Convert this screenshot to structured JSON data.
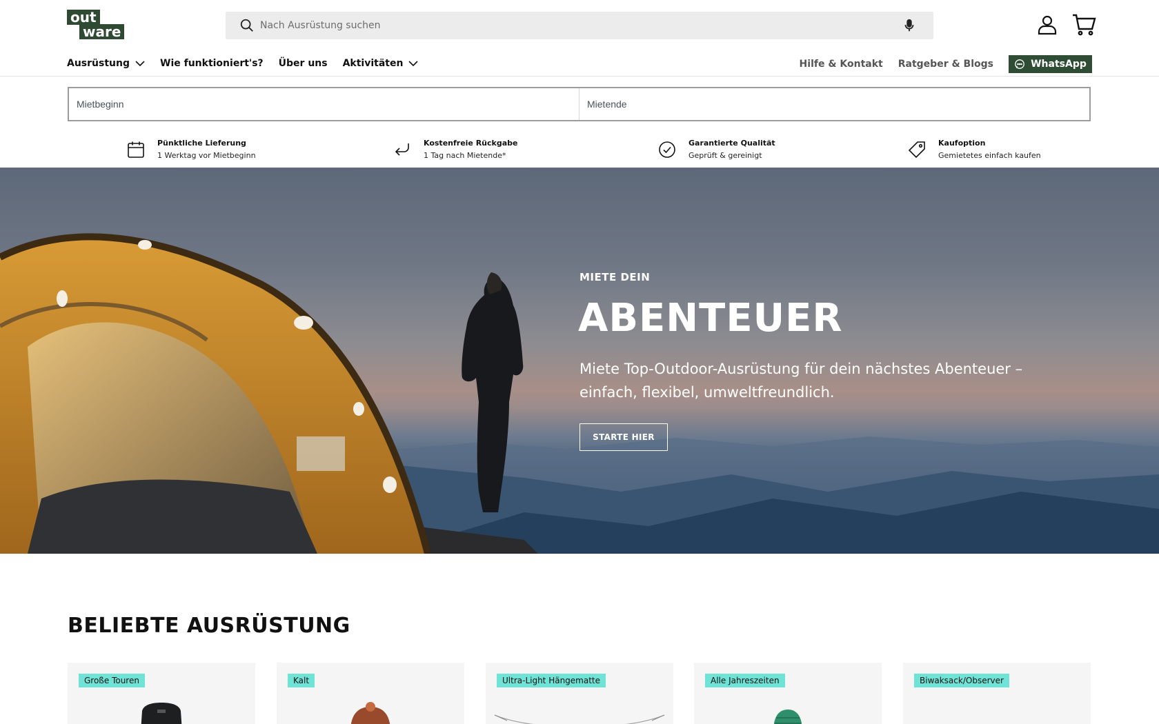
{
  "brand": {
    "logo_line1": "out",
    "logo_line2": "ware",
    "color": "#2e4a33"
  },
  "search": {
    "placeholder": "Nach Ausrüstung suchen"
  },
  "nav": {
    "left": [
      {
        "label": "Ausrüstung",
        "has_dropdown": true
      },
      {
        "label": "Wie funktioniert's?",
        "has_dropdown": false
      },
      {
        "label": "Über uns",
        "has_dropdown": false
      },
      {
        "label": "Aktivitäten",
        "has_dropdown": true
      }
    ],
    "right": [
      {
        "label": "Hilfe & Kontakt"
      },
      {
        "label": "Ratgeber & Blogs"
      }
    ],
    "whatsapp_label": "WhatsApp"
  },
  "dates": {
    "start_placeholder": "Mietbeginn",
    "end_placeholder": "Mietende"
  },
  "usps": [
    {
      "icon": "calendar-icon",
      "title": "Pünktliche Lieferung",
      "subtitle": "1 Werktag vor Mietbeginn"
    },
    {
      "icon": "return-arrow-icon",
      "title": "Kostenfreie Rückgabe",
      "subtitle": "1 Tag nach Mietende*"
    },
    {
      "icon": "check-circle-icon",
      "title": "Garantierte Qualität",
      "subtitle": "Geprüft & gereinigt"
    },
    {
      "icon": "price-tag-icon",
      "title": "Kaufoption",
      "subtitle": "Gemietetes einfach kaufen"
    }
  ],
  "hero": {
    "eyebrow": "MIETE DEIN",
    "title": "ABENTEUER",
    "lead": "Miete Top-Outdoor-Ausrüstung für dein nächstes Abenteuer – einfach, flexibel, umweltfreundlich.",
    "cta": "STARTE HIER"
  },
  "popular": {
    "title": "BELIEBTE AUSRÜSTUNG",
    "cards": [
      {
        "badge": "Große Touren"
      },
      {
        "badge": "Kalt"
      },
      {
        "badge": "Ultra-Light Hängematte"
      },
      {
        "badge": "Alle Jahreszeiten"
      },
      {
        "badge": "Biwaksack/Observer"
      }
    ]
  },
  "colors": {
    "accent_green": "#2f4d35",
    "badge_teal": "#6fe3d5",
    "search_bg": "#ececec"
  }
}
